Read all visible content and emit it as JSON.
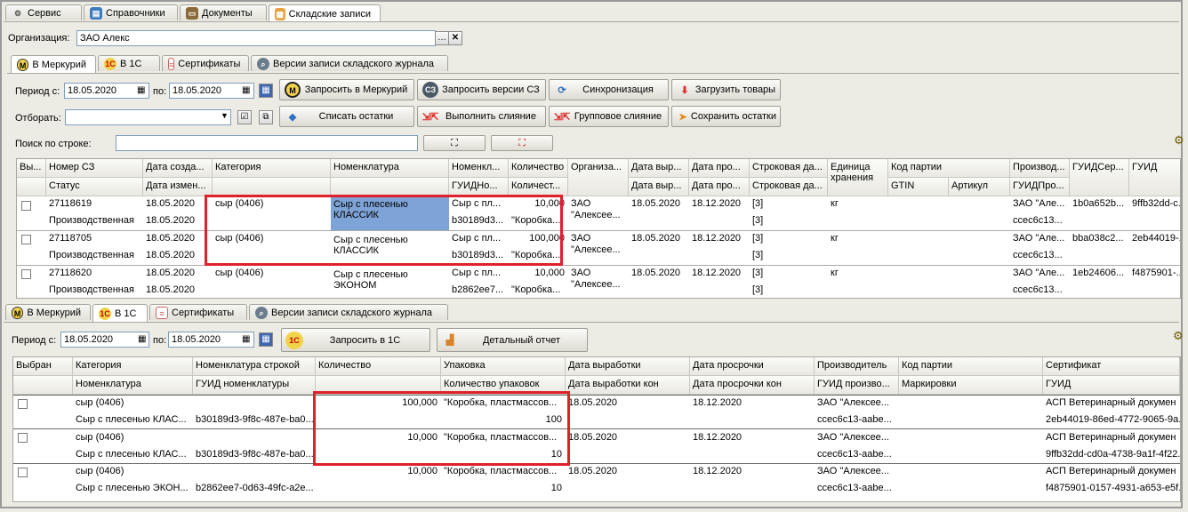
{
  "top_tabs": [
    "Сервис",
    "Справочники",
    "Документы",
    "Складские записи"
  ],
  "org": {
    "label": "Организация:",
    "value": "ЗАО  Алекс"
  },
  "upper_tabs": [
    "В Меркурий",
    "В 1С",
    "Сертификаты",
    "Версии записи складского журнала"
  ],
  "upper_toolbar": {
    "period_label": "Период с:",
    "date_from": "18.05.2020",
    "to_label": "по:",
    "date_to": "18.05.2020",
    "filter_label": "Отборать:",
    "search_label": "Поиск по строке:",
    "buttons": [
      "Запросить в Меркурий",
      "Запросить версии СЗ",
      "Синхронизация",
      "Загрузить товары",
      "Списать остатки",
      "Выполнить слияние",
      "Групповое слияние",
      "Сохранить остатки"
    ]
  },
  "upper_grid": {
    "headers_top": [
      "Вы...",
      "Номер СЗ",
      "Дата созда...",
      "Категория",
      "Номенклатура",
      "Номенкл...",
      "Количество",
      "Организа...",
      "Дата выр...",
      "Дата про...",
      "Строковая да...",
      "Единица хранения",
      "Код партии",
      "",
      "Производ...",
      "ГУИДСер...",
      "ГУИД"
    ],
    "headers_bottom": [
      "",
      "Статус",
      "Дата измен...",
      "",
      "",
      "ГУИДНо...",
      "Количест...",
      "",
      "Дата выр...",
      "Дата про...",
      "Строковая да...",
      "",
      "GTIN",
      "Артикул",
      "ГУИДПро...",
      "",
      ""
    ],
    "rows": [
      {
        "num": "27118619",
        "status": "Производственная",
        "date1": "18.05.2020",
        "date2": "18.05.2020",
        "category": "сыр (0406)",
        "nom": "Сыр с плесенью КЛАССИК",
        "nom_short": "Сыр с пл...",
        "guid_nom": "b30189d3...",
        "qty": "10,000",
        "qty_pack": "\"Коробка...",
        "org": "ЗАО \"Алексее...",
        "date_prod": "18.05.2020",
        "date_exp": "18.12.2020",
        "str_date1": "[3]",
        "str_date2": "[3]",
        "unit": "кг",
        "producer": "ЗАО \"Але...",
        "guid_prod": "ccec6c13...",
        "guid_cert": "1b0a652b...",
        "guid": "9ffb32dd-c..."
      },
      {
        "num": "27118705",
        "status": "Производственная",
        "date1": "18.05.2020",
        "date2": "18.05.2020",
        "category": "сыр (0406)",
        "nom": "Сыр с плесенью КЛАССИК",
        "nom_short": "Сыр с пл...",
        "guid_nom": "b30189d3...",
        "qty": "100,000",
        "qty_pack": "\"Коробка...",
        "org": "ЗАО \"Алексее...",
        "date_prod": "18.05.2020",
        "date_exp": "18.12.2020",
        "str_date1": "[3]",
        "str_date2": "[3]",
        "unit": "кг",
        "producer": "ЗАО \"Але...",
        "guid_prod": "ccec6c13...",
        "guid_cert": "bba038c2...",
        "guid": "2eb44019-..."
      },
      {
        "num": "27118620",
        "status": "Производственная",
        "date1": "18.05.2020",
        "date2": "18.05.2020",
        "category": "сыр (0406)",
        "nom": "Сыр с плесенью ЭКОНОМ",
        "nom_short": "Сыр с пл...",
        "guid_nom": "b2862ee7...",
        "qty": "10,000",
        "qty_pack": "\"Коробка...",
        "org": "ЗАО \"Алексее...",
        "date_prod": "18.05.2020",
        "date_exp": "18.12.2020",
        "str_date1": "[3]",
        "str_date2": "[3]",
        "unit": "кг",
        "producer": "ЗАО \"Але...",
        "guid_prod": "ccec6c13...",
        "guid_cert": "1eb24606...",
        "guid": "f4875901-..."
      }
    ]
  },
  "lower_tabs": [
    "В Меркурий",
    "В 1С",
    "Сертификаты",
    "Версии записи складского журнала"
  ],
  "lower_toolbar": {
    "period_label": "Период с:",
    "date_from": "18.05.2020",
    "to_label": "по:",
    "date_to": "18.05.2020",
    "buttons": [
      "Запросить в 1С",
      "Детальный отчет"
    ]
  },
  "lower_grid": {
    "headers_top": [
      "Выбран",
      "Категория",
      "Номенклатура строкой",
      "Количество",
      "Упаковка",
      "Дата выработки",
      "Дата просрочки",
      "Производитель",
      "Код партии",
      "Сертификат"
    ],
    "headers_bottom": [
      "",
      "Номенклатура",
      "ГУИД номенклатуры",
      "",
      "Количество упаковок",
      "Дата выработки кон",
      "Дата просрочки кон",
      "ГУИД произво...",
      "Маркировки",
      "ГУИД"
    ],
    "rows": [
      {
        "category": "сыр (0406)",
        "nom": "Сыр с плесенью КЛАС...",
        "guid_nom": "b30189d3-9f8c-487e-ba0...",
        "qty": "100,000",
        "pack": "\"Коробка, пластмассов...",
        "pack_count": "100",
        "date_prod": "18.05.2020",
        "date_exp": "18.12.2020",
        "producer": "ЗАО \"Алексее...",
        "guid_prod": "ccec6c13-aabe...",
        "cert": "АСП Ветеринарный докумен",
        "guid": "2eb44019-86ed-4772-9065-9a..."
      },
      {
        "category": "сыр (0406)",
        "nom": "Сыр с плесенью КЛАС...",
        "guid_nom": "b30189d3-9f8c-487e-ba0...",
        "qty": "10,000",
        "pack": "\"Коробка, пластмассов...",
        "pack_count": "10",
        "date_prod": "18.05.2020",
        "date_exp": "18.12.2020",
        "producer": "ЗАО \"Алексее...",
        "guid_prod": "ccec6c13-aabe...",
        "cert": "АСП Ветеринарный докумен",
        "guid": "9ffb32dd-cd0a-4738-9a1f-4f22..."
      },
      {
        "category": "сыр (0406)",
        "nom": "Сыр с плесенью ЭКОН...",
        "guid_nom": "b2862ee7-0d63-49fc-a2e...",
        "qty": "10,000",
        "pack": "\"Коробка, пластмассов...",
        "pack_count": "10",
        "date_prod": "18.05.2020",
        "date_exp": "18.12.2020",
        "producer": "ЗАО \"Алексее...",
        "guid_prod": "ccec6c13-aabe...",
        "cert": "АСП Ветеринарный докумен",
        "guid": "f4875901-0157-4931-a653-e5f..."
      }
    ]
  },
  "colors": {
    "highlight": "#e0202a",
    "selection": "#7ea3d6"
  }
}
